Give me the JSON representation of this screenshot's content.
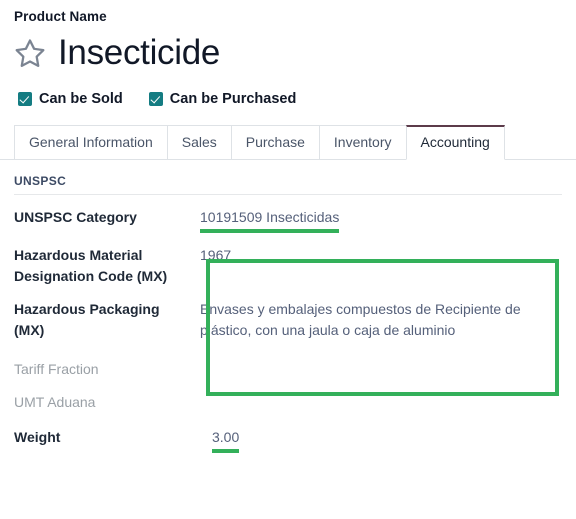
{
  "header": {
    "product_name_label": "Product Name",
    "star_icon": "star-outline-icon",
    "title": "Insecticide"
  },
  "checkboxes": [
    {
      "label": "Can be Sold",
      "checked": true,
      "icon": "checkmark-icon"
    },
    {
      "label": "Can be Purchased",
      "checked": true,
      "icon": "checkmark-icon"
    }
  ],
  "tabs": [
    {
      "label": "General Information",
      "active": false
    },
    {
      "label": "Sales",
      "active": false
    },
    {
      "label": "Purchase",
      "active": false
    },
    {
      "label": "Inventory",
      "active": false
    },
    {
      "label": "Accounting",
      "active": true
    }
  ],
  "form": {
    "section_title": "UNSPSC",
    "fields": [
      {
        "label": "UNSPSC Category",
        "value": "10191509 Insecticidas",
        "muted": false,
        "underlined": true
      },
      {
        "label": "Hazardous Material Designation Code (MX)",
        "value": "1967",
        "muted": false,
        "underlined": false
      },
      {
        "label": "Hazardous Packaging (MX)",
        "value": "Envases y embalajes compuestos de Recipiente de plástico, con una jaula o caja de aluminio",
        "muted": false,
        "underlined": false
      },
      {
        "label": "Tariff Fraction",
        "value": "",
        "muted": true,
        "underlined": false
      },
      {
        "label": "UMT Aduana",
        "value": "",
        "muted": true,
        "underlined": false
      },
      {
        "label": "Weight",
        "value": "3.00",
        "muted": false,
        "underlined": true
      }
    ]
  },
  "colors": {
    "highlight_green": "#33b05a",
    "checkbox_teal": "#147c82",
    "active_tab_border": "#5c3b4a",
    "value_text": "#55607a",
    "muted_label": "#9aa0a6"
  }
}
